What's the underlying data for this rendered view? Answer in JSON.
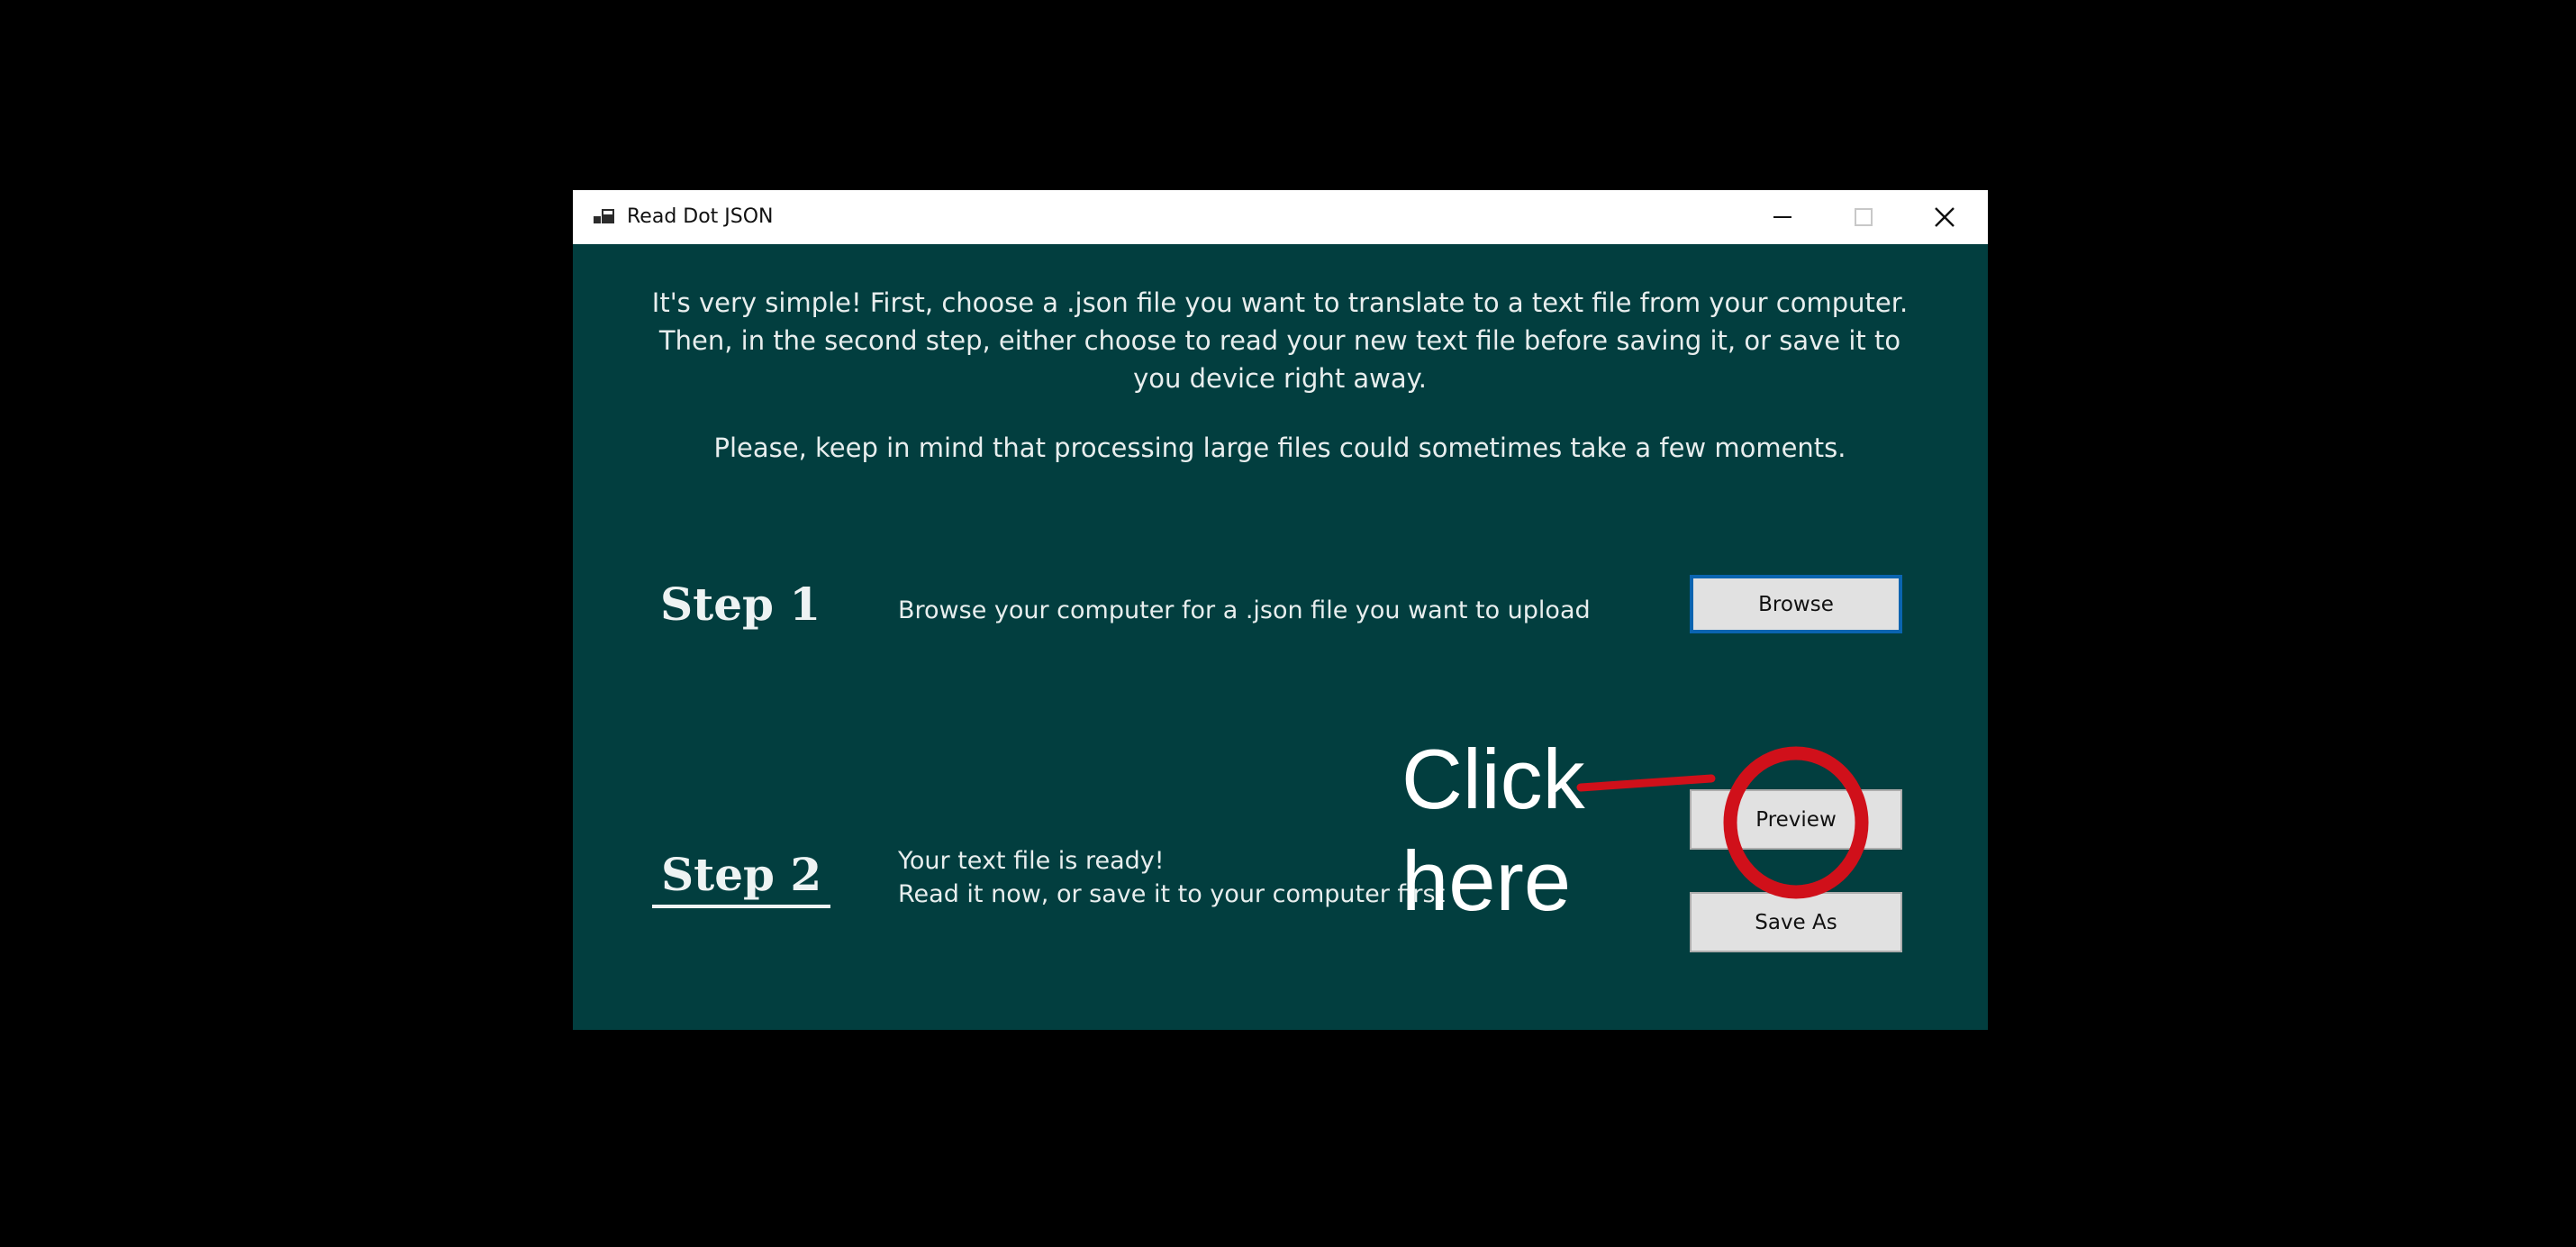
{
  "window": {
    "title": "Read Dot JSON",
    "controls": {
      "minimize": "minimize-icon",
      "maximize": "maximize-icon",
      "close": "close-icon"
    },
    "background_color": "#023e3f"
  },
  "intro": {
    "line1": "It's very simple! First, choose a .json file you want to translate to a text file from your computer.",
    "line2": "Then, in the second step, either choose to read your new text file before saving it, or save it to",
    "line3": "you device right away.",
    "note": "Please, keep in mind that processing large files could sometimes take a few moments."
  },
  "step1": {
    "heading": "Step 1",
    "description": "Browse your computer for a .json file you want to upload",
    "browse_label": "Browse"
  },
  "step2": {
    "heading": "Step 2",
    "description_line1": "Your text file is ready!",
    "description_line2": "Read it now, or save it to your computer first",
    "preview_label": "Preview",
    "save_as_label": "Save As"
  },
  "annotation": {
    "line1": "Click",
    "line2": "here",
    "color": "#d0101a"
  }
}
